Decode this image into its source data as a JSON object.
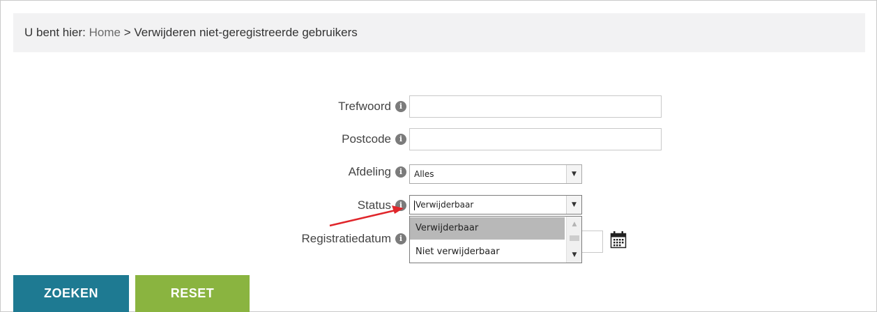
{
  "breadcrumb": {
    "prefix": "U bent hier:",
    "home": "Home",
    "separator": ">",
    "current": "Verwijderen niet-geregistreerde gebruikers"
  },
  "form": {
    "info_glyph": "i",
    "trefwoord": {
      "label": "Trefwoord",
      "value": ""
    },
    "postcode": {
      "label": "Postcode",
      "value": ""
    },
    "afdeling": {
      "label": "Afdeling",
      "selected": "Alles"
    },
    "status": {
      "label": "Status",
      "selected": "Verwijderbaar",
      "options": [
        "Verwijderbaar",
        "Niet verwijderbaar"
      ]
    },
    "registratiedatum": {
      "label": "Registratiedatum",
      "value": ""
    }
  },
  "buttons": {
    "search_label": "ZOEKEN",
    "reset_label": "RESET"
  },
  "colors": {
    "search_button": "#1e7a92",
    "reset_button": "#8ab440",
    "annotation_arrow": "#e0262b",
    "breadcrumb_bg": "#f2f2f3"
  },
  "icons": {
    "info": "info-icon",
    "dropdown": "chevron-down-icon",
    "calendar": "calendar-icon"
  }
}
